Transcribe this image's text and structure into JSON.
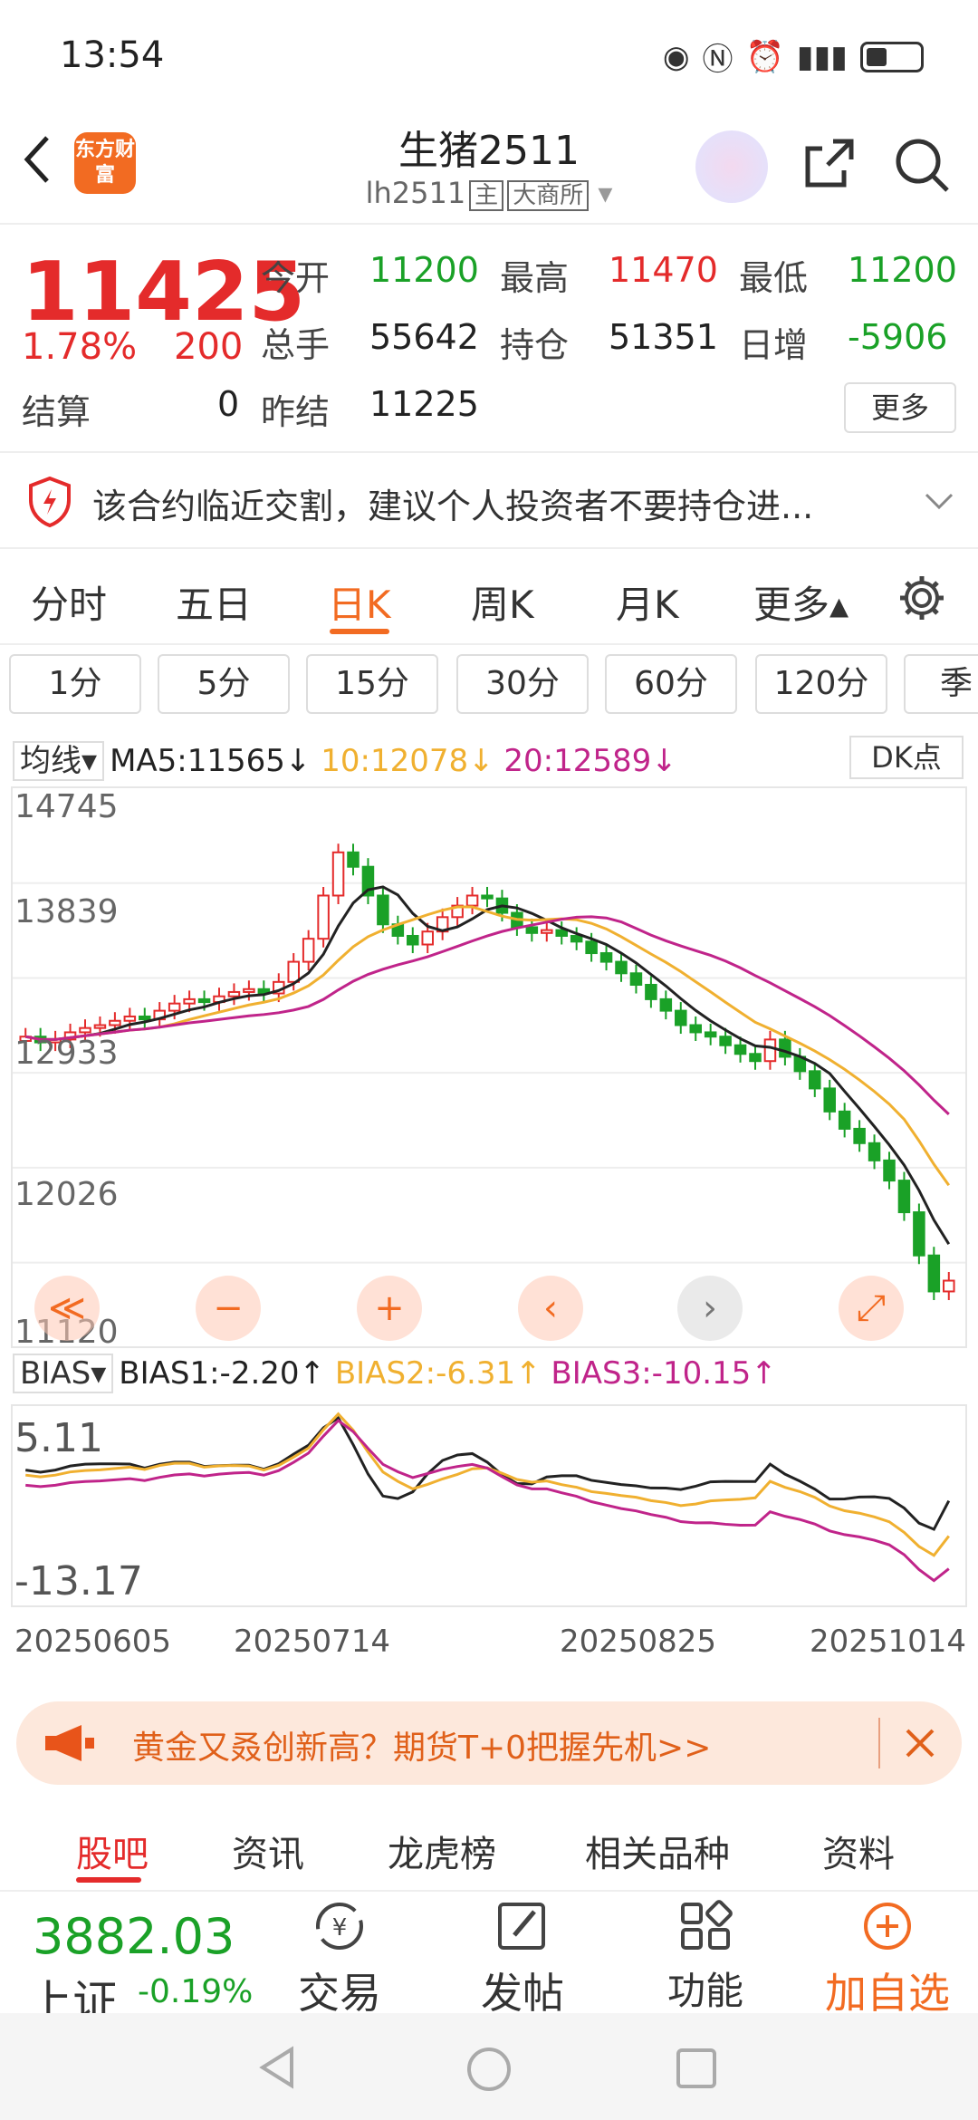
{
  "status_bar": {
    "time": "13:54"
  },
  "header": {
    "title": "生猪2511",
    "code": "lh2511",
    "tag_main": "主",
    "exchange": "大商所",
    "logo_text": "东方财富"
  },
  "quote": {
    "price": "11425",
    "pct": "1.78%",
    "change": "200",
    "open_label": "今开",
    "open": "11200",
    "high_label": "最高",
    "high": "11470",
    "low_label": "最低",
    "low": "11200",
    "volume_label": "总手",
    "volume": "55642",
    "oi_label": "持仓",
    "oi": "51351",
    "daily_inc_label": "日增",
    "daily_inc": "-5906",
    "settle_label": "结算",
    "settle": "0",
    "prev_settle_label": "昨结",
    "prev_settle": "11225",
    "more_label": "更多"
  },
  "notice": {
    "text": "该合约临近交割，建议个人投资者不要持仓进..."
  },
  "period_tabs": [
    "分时",
    "五日",
    "日K",
    "周K",
    "月K",
    "更多▴"
  ],
  "interval_buttons": [
    "1分",
    "5分",
    "15分",
    "30分",
    "60分",
    "120分",
    "季"
  ],
  "ma": {
    "selector": "均线",
    "ma5": "MA5:11565↓",
    "ma10": "10:12078↓",
    "ma20": "20:12589↓",
    "dk_label": "DK点"
  },
  "price_axis": [
    "14745",
    "13839",
    "12933",
    "12026",
    "11120"
  ],
  "bias": {
    "selector": "BIAS",
    "b1": "BIAS1:-2.20↑",
    "b2": "BIAS2:-6.31↑",
    "b3": "BIAS3:-10.15↑",
    "top": "5.11",
    "bottom": "-13.17"
  },
  "dates": [
    "20250605",
    "20250714",
    "20250825",
    "20251014"
  ],
  "chart_nav": [
    "≪",
    "−",
    "+",
    "‹",
    "›",
    "⤢"
  ],
  "ad": {
    "text": "黄金又叒创新高？期货T+0把握先机>>"
  },
  "bottom_tabs": [
    "股吧",
    "资讯",
    "龙虎榜",
    "相关品种",
    "资料"
  ],
  "index": {
    "value": "3882.03",
    "name": "上证",
    "pct": "-0.19%"
  },
  "toolbar": {
    "trade": "交易",
    "post": "发帖",
    "func": "功能",
    "add": "加自选"
  },
  "colors": {
    "up": "#e42b2b",
    "down": "#1aa127",
    "accent": "#f26b22",
    "ma10": "#f0b030",
    "ma20": "#c0248a"
  },
  "chart_data": {
    "type": "candlestick",
    "x_range": [
      "20250605",
      "20251014"
    ],
    "ylim": [
      11120,
      14745
    ],
    "close_series_approx": [
      13120,
      13080,
      13100,
      13150,
      13180,
      13200,
      13230,
      13260,
      13240,
      13300,
      13350,
      13380,
      13360,
      13400,
      13430,
      13450,
      13420,
      13500,
      13640,
      13800,
      14100,
      14400,
      14300,
      14100,
      13900,
      13820,
      13760,
      13850,
      13950,
      14030,
      14100,
      14080,
      13980,
      13880,
      13840,
      13860,
      13820,
      13780,
      13700,
      13640,
      13560,
      13480,
      13380,
      13300,
      13200,
      13150,
      13120,
      13060,
      13000,
      12950,
      13100,
      12980,
      12880,
      12760,
      12600,
      12480,
      12380,
      12260,
      12120,
      11900,
      11600,
      11350,
      11425
    ]
  }
}
